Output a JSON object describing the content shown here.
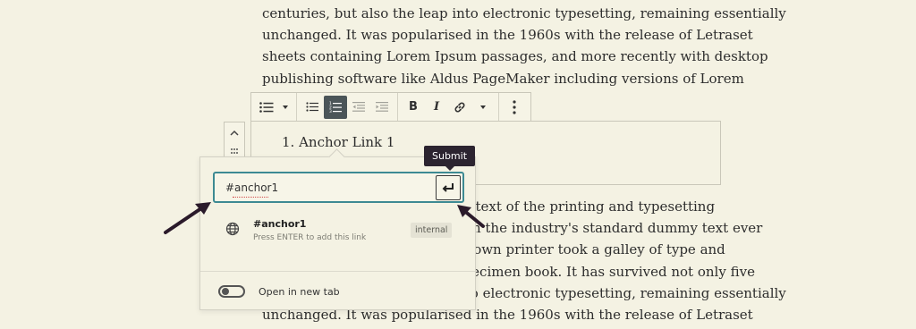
{
  "paragraph_top": {
    "lines": [
      "centuries, but also the leap into electronic typesetting, remaining essentially",
      "unchanged. It was popularised in the 1960s with the release of Letraset",
      "sheets containing Lorem Ipsum passages, and more recently with desktop",
      "publishing software like Aldus PageMaker including versions of Lorem"
    ]
  },
  "paragraph_bottom": {
    "lines": [
      "Lorem Ipsum is simply dummy text of the printing and typesetting",
      "industry. Lorem Ipsum has been the industry's standard dummy text ever",
      "since the 1500s, when an unknown printer took a galley of type and",
      "scrambled it to make a type specimen book. It has survived not only five",
      "centuries, but also the leap into electronic typesetting, remaining essentially",
      "unchanged. It was popularised in the 1960s with the release of Letraset"
    ]
  },
  "list_block": {
    "item": "1. Anchor Link 1"
  },
  "tooltip": {
    "label": "Submit"
  },
  "link_popover": {
    "input_value": "#anchor1",
    "suggestion_title": "#anchor1",
    "suggestion_hint": "Press ENTER to add this link",
    "suggestion_badge": "internal",
    "toggle_label": "Open in new tab",
    "toggle_on": false
  },
  "colors": {
    "page_background": "#f4f2e3",
    "focus_border": "#3d8a93",
    "active_button": "#4b5558",
    "tooltip_background": "#2c2430",
    "annotation_arrow": "#2a1a2a"
  },
  "icons": {
    "toolbar": [
      "list-icon",
      "chevron-down-icon",
      "unordered-list-icon",
      "ordered-list-icon",
      "outdent-icon",
      "indent-icon",
      "bold-icon",
      "italic-icon",
      "link-icon",
      "chevron-down-icon",
      "more-options-icon"
    ],
    "mover": [
      "chevron-up-icon",
      "drag-handle-icon"
    ],
    "submit": "enter-icon",
    "suggestion": "globe-icon"
  }
}
